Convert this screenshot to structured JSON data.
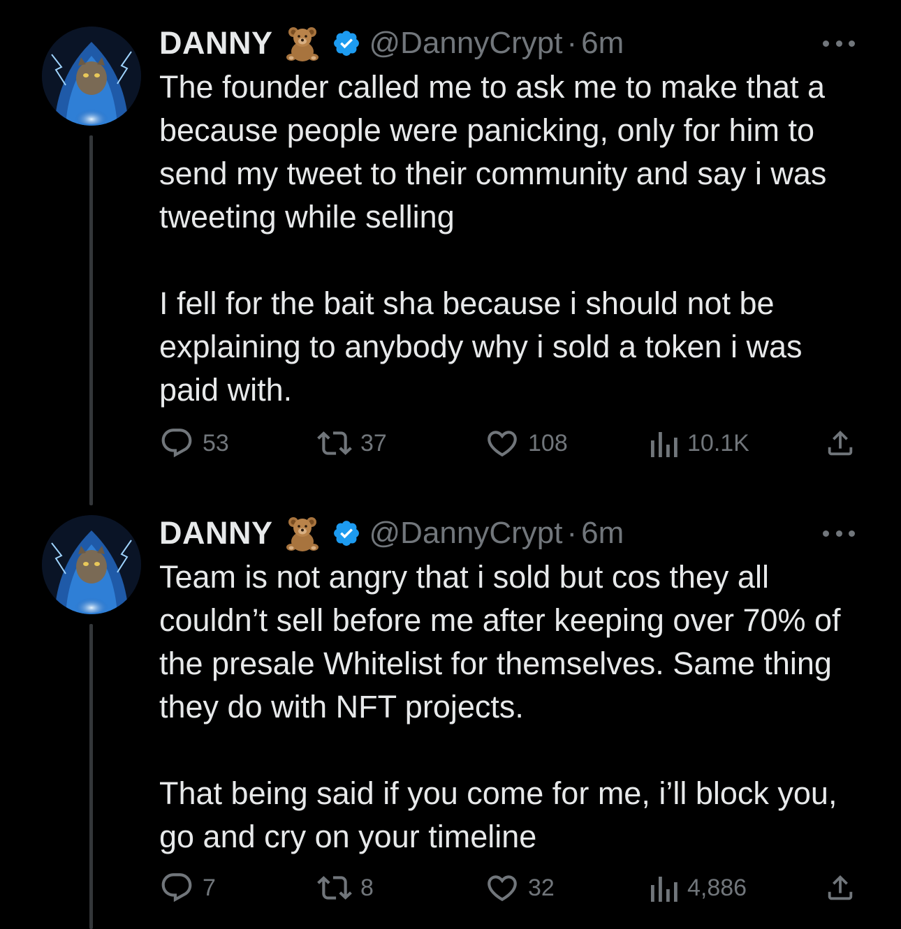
{
  "tweets": [
    {
      "display_name": "DANNY",
      "emoji": "🧸",
      "handle": "@DannyCrypt",
      "separator": "·",
      "time": "6m",
      "text": "The founder called me to ask me to make that a because people were panicking, only for him to send my tweet to their community and say i was tweeting while selling\n\nI fell for the bait sha because i should not be explaining to anybody why i sold a token i was paid with.",
      "replies": "53",
      "retweets": "37",
      "likes": "108",
      "views": "10.1K"
    },
    {
      "display_name": "DANNY",
      "emoji": "🧸",
      "handle": "@DannyCrypt",
      "separator": "·",
      "time": "6m",
      "text": "Team is not angry that i sold but cos they all couldn’t sell before me after keeping over 70% of the presale Whitelist for themselves. Same thing they do with NFT projects.\n\nThat being said if you come for me, i’ll block you, go and cry on your timeline",
      "replies": "7",
      "retweets": "8",
      "likes": "32",
      "views": "4,886"
    }
  ],
  "icons": [
    "avatar-hooded-cat",
    "teddy-bear-icon",
    "verified-badge-icon",
    "more-icon",
    "reply-icon",
    "retweet-icon",
    "like-icon",
    "views-icon",
    "share-icon"
  ],
  "colors": {
    "background": "#000000",
    "text": "#e7e9ea",
    "muted": "#71767b",
    "verified": "#1d9bf0"
  }
}
